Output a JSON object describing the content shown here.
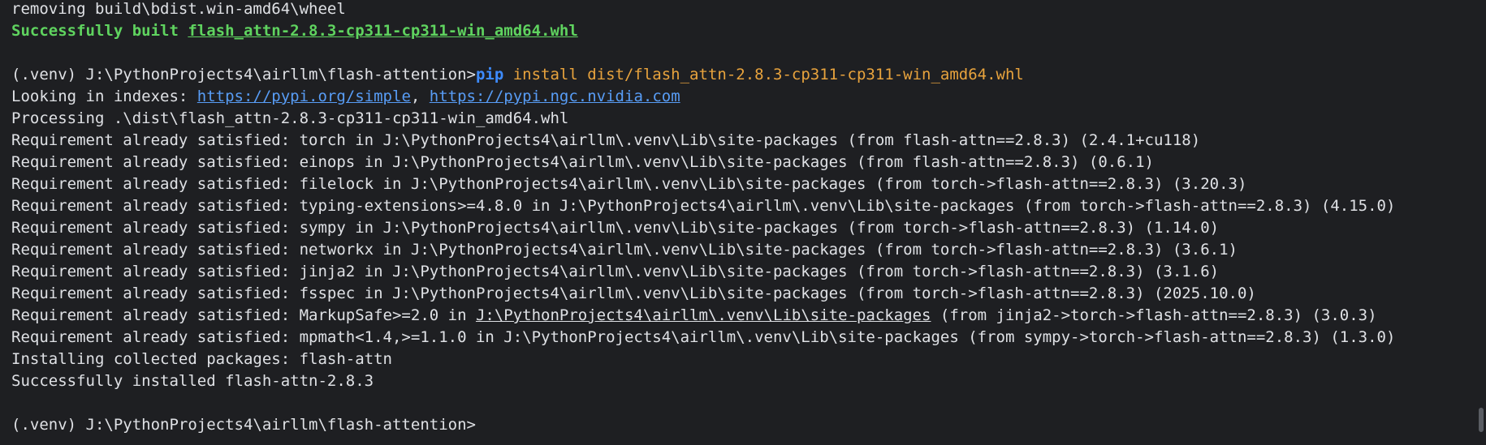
{
  "terminal": {
    "line_removing": "removing build\\bdist.win-amd64\\wheel",
    "built_prefix": "Successfully built ",
    "built_link": "flash_attn-2.8.3-cp311-cp311-win_amd64.whl",
    "prompt1": "(.venv) J:\\PythonProjects4\\airllm\\flash-attention>",
    "cmd_pip": "pip",
    "cmd_args": " install dist/flash_attn-2.8.3-cp311-cp311-win_amd64.whl",
    "looking_prefix": "Looking in indexes: ",
    "index_url_1": "https://pypi.org/simple",
    "index_sep": ", ",
    "index_url_2": "https://pypi.ngc.nvidia.com",
    "processing": "Processing .\\dist\\flash_attn-2.8.3-cp311-cp311-win_amd64.whl",
    "requirements": [
      "Requirement already satisfied: torch in J:\\PythonProjects4\\airllm\\.venv\\Lib\\site-packages (from flash-attn==2.8.3) (2.4.1+cu118)",
      "Requirement already satisfied: einops in J:\\PythonProjects4\\airllm\\.venv\\Lib\\site-packages (from flash-attn==2.8.3) (0.6.1)",
      "Requirement already satisfied: filelock in J:\\PythonProjects4\\airllm\\.venv\\Lib\\site-packages (from torch->flash-attn==2.8.3) (3.20.3)",
      "Requirement already satisfied: typing-extensions>=4.8.0 in J:\\PythonProjects4\\airllm\\.venv\\Lib\\site-packages (from torch->flash-attn==2.8.3) (4.15.0)",
      "Requirement already satisfied: sympy in J:\\PythonProjects4\\airllm\\.venv\\Lib\\site-packages (from torch->flash-attn==2.8.3) (1.14.0)",
      "Requirement already satisfied: networkx in J:\\PythonProjects4\\airllm\\.venv\\Lib\\site-packages (from torch->flash-attn==2.8.3) (3.6.1)",
      "Requirement already satisfied: jinja2 in J:\\PythonProjects4\\airllm\\.venv\\Lib\\site-packages (from torch->flash-attn==2.8.3) (3.1.6)",
      "Requirement already satisfied: fsspec in J:\\PythonProjects4\\airllm\\.venv\\Lib\\site-packages (from torch->flash-attn==2.8.3) (2025.10.0)"
    ],
    "markupsafe_prefix": "Requirement already satisfied: MarkupSafe>=2.0 in ",
    "markupsafe_path": "J:\\PythonProjects4\\airllm\\.venv\\Lib\\site-packages",
    "markupsafe_suffix": " (from jinja2->torch->flash-attn==2.8.3) (3.0.3)",
    "mpmath_line": "Requirement already satisfied: mpmath<1.4,>=1.1.0 in J:\\PythonProjects4\\airllm\\.venv\\Lib\\site-packages (from sympy->torch->flash-attn==2.8.3) (1.3.0)",
    "installing": "Installing collected packages: flash-attn",
    "installed": "Successfully installed flash-attn-2.8.3",
    "prompt2": "(.venv) J:\\PythonProjects4\\airllm\\flash-attention>"
  },
  "colors": {
    "background": "#1e1f22",
    "text": "#dfe1e5",
    "success": "#5fd35f",
    "link": "#589df6",
    "pip_command": "#3d8bff",
    "command_args": "#e8a33d"
  }
}
